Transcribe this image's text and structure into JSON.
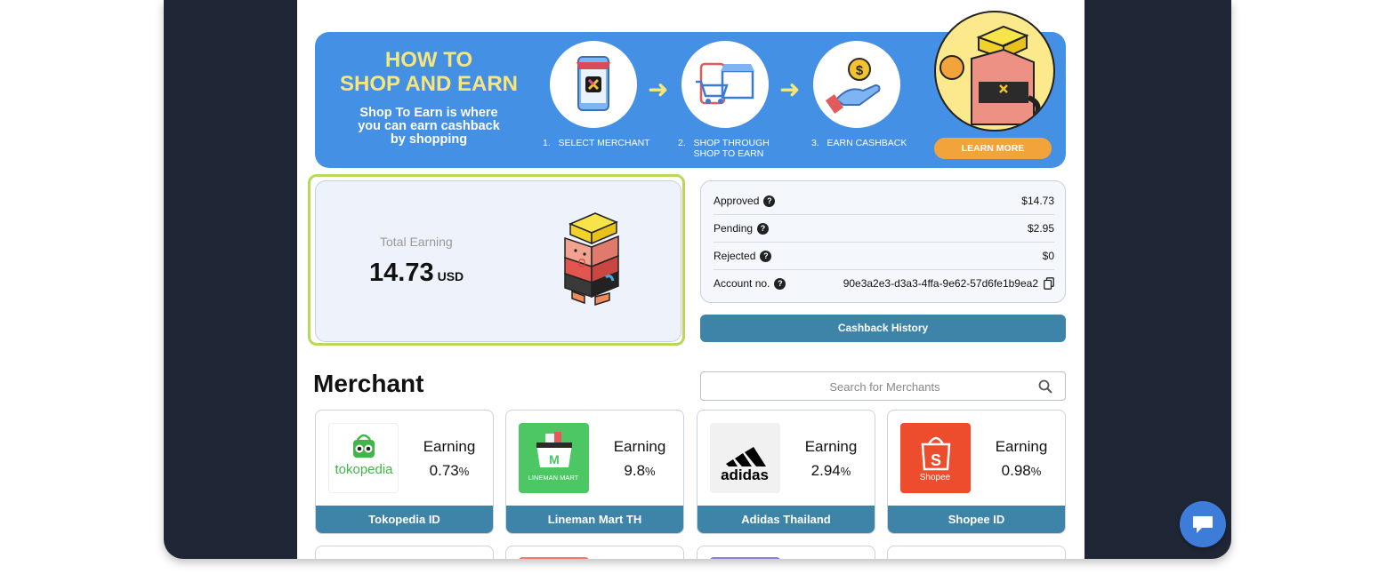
{
  "banner": {
    "title_line1": "HOW TO",
    "title_line2": "SHOP AND EARN",
    "subtitle_line1": "Shop To Earn is where",
    "subtitle_line2": "you can earn cashback",
    "subtitle_line3": "by shopping",
    "steps": [
      {
        "label": "1.   SELECT MERCHANT",
        "icon": "phone-store-icon"
      },
      {
        "label": "2.   SHOP THROUGH\n      SHOP TO EARN",
        "icon": "cart-store-icon"
      },
      {
        "label": "3.   EARN CASHBACK",
        "icon": "hand-coin-icon"
      }
    ],
    "learn_more": "LEARN MORE"
  },
  "earning": {
    "label": "Total Earning",
    "value": "14.73",
    "unit": "USD"
  },
  "stats": {
    "approved_label": "Approved",
    "approved_value": "$14.73",
    "pending_label": "Pending",
    "pending_value": "$2.95",
    "rejected_label": "Rejected",
    "rejected_value": "$0",
    "account_label": "Account no.",
    "account_value": "90e3a2e3-d3a3-4ffa-9e62-57d6fe1b9ea2",
    "help_glyph": "?"
  },
  "cashback_history": "Cashback History",
  "merchant": {
    "title": "Merchant",
    "search_placeholder": "Search for Merchants",
    "earning_label": "Earning",
    "pct_sign": "%",
    "items": [
      {
        "name": "Tokopedia ID",
        "earning": "0.73",
        "logo_text": "tokopedia",
        "brand_color": "#42b549"
      },
      {
        "name": "Lineman Mart TH",
        "earning": "9.8",
        "logo_text": "LINEMAN MART",
        "brand_color": "#4cc764"
      },
      {
        "name": "Adidas Thailand",
        "earning": "2.94",
        "logo_text": "adidas",
        "brand_color": "#000000"
      },
      {
        "name": "Shopee ID",
        "earning": "0.98",
        "logo_text": "Shopee",
        "brand_color": "#ee4d2d"
      }
    ]
  },
  "colors": {
    "banner_bg": "#4490e4",
    "banner_title": "#f7e77a",
    "accent_button": "#3d84a8",
    "highlight_border": "#b6d95a",
    "learn_more_bg": "#f2a43a",
    "chat_bg": "#3d7cd9"
  }
}
